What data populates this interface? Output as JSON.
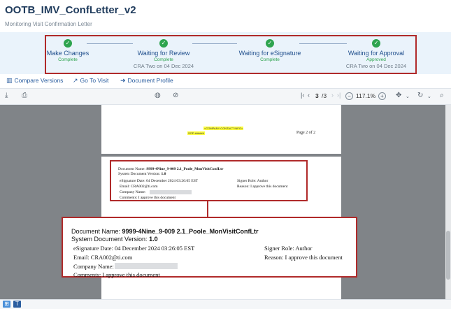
{
  "header": {
    "title": "OOTB_IMV_ConfLetter_v2",
    "subtitle": "Monitoring Visit Confirmation Letter"
  },
  "steps": [
    {
      "label": "Make Changes",
      "status": "Complete",
      "sub": ""
    },
    {
      "label": "Waiting for Review",
      "status": "Complete",
      "sub": "CRA Two on 04 Dec 2024"
    },
    {
      "label": "Waiting for eSignature",
      "status": "Complete",
      "sub": ""
    },
    {
      "label": "Waiting for Approval",
      "status": "Approved",
      "sub": "CRA Two on 04 Dec 2024"
    }
  ],
  "actions": {
    "compare": "Compare Versions",
    "goto": "Go To Visit",
    "profile": "Document Profile"
  },
  "viewer": {
    "page_current": "3",
    "page_total": "/3",
    "zoom": "117.1%"
  },
  "page1": {
    "highlight1": "<COMPANY CONTACT INFO>",
    "highlight2": "SOP ######",
    "page_number": "Page 2 of 2"
  },
  "signature": {
    "doc_name_label": "Document Name:",
    "doc_name": "9999-4Nine_9-009 2.1_Poole_MonVisitConfLtr",
    "sys_version_label": "System Document Version:",
    "sys_version": "1.0",
    "esig_date": "eSignature Date:  04 December 2024 03:26:05 EST",
    "email": "Email:  CRA002@ti.com",
    "company": "Company Name:",
    "comments": "Comments:  I approve this document",
    "signer_role": "Signer Role:  Author",
    "reason": "Reason:  I approve this document"
  },
  "colors": {
    "accent": "#2a5d9f",
    "complete": "#2ea44f",
    "highlight_box": "#b02a2a"
  }
}
